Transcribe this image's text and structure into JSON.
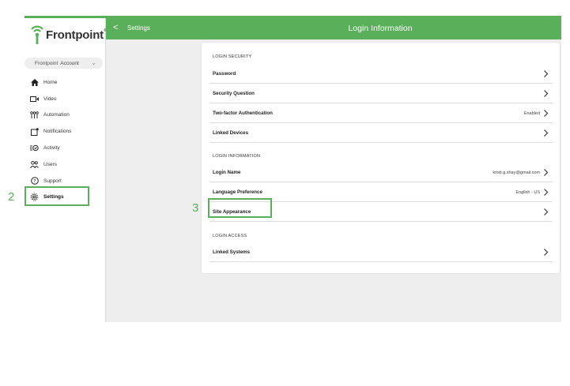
{
  "brand": {
    "name": "Frontpoint",
    "trademark": "®"
  },
  "account": {
    "brand": "Frontpoint",
    "label": "Account"
  },
  "sidebar": {
    "items": [
      {
        "label": "Home",
        "icon": "home-icon"
      },
      {
        "label": "Video",
        "icon": "video-icon"
      },
      {
        "label": "Automation",
        "icon": "automation-icon"
      },
      {
        "label": "Notifications",
        "icon": "notifications-icon"
      },
      {
        "label": "Activity",
        "icon": "activity-icon"
      },
      {
        "label": "Users",
        "icon": "users-icon"
      },
      {
        "label": "Support",
        "icon": "support-icon"
      },
      {
        "label": "Settings",
        "icon": "settings-icon"
      }
    ]
  },
  "header": {
    "back_label": "<",
    "breadcrumb": "Settings",
    "title": "Login Information"
  },
  "sections": {
    "security": {
      "heading": "LOGIN SECURITY",
      "password": "Password",
      "question": "Security Question",
      "twofactor": "Two-factor Authentication",
      "twofactor_value": "Enabled",
      "devices": "Linked Devices"
    },
    "information": {
      "heading": "LOGIN INFORMATION",
      "login_name": "Login Name",
      "login_name_value": "kristi.g.shay@gmail.com",
      "language": "Language Preference",
      "language_value": "English - US",
      "appearance": "Site Appearance"
    },
    "access": {
      "heading": "LOGIN ACCESS",
      "systems": "Linked Systems"
    }
  },
  "annotations": {
    "step2": "2",
    "step3": "3"
  },
  "colors": {
    "accent": "#5aaf5a",
    "background": "#eeeeee"
  }
}
